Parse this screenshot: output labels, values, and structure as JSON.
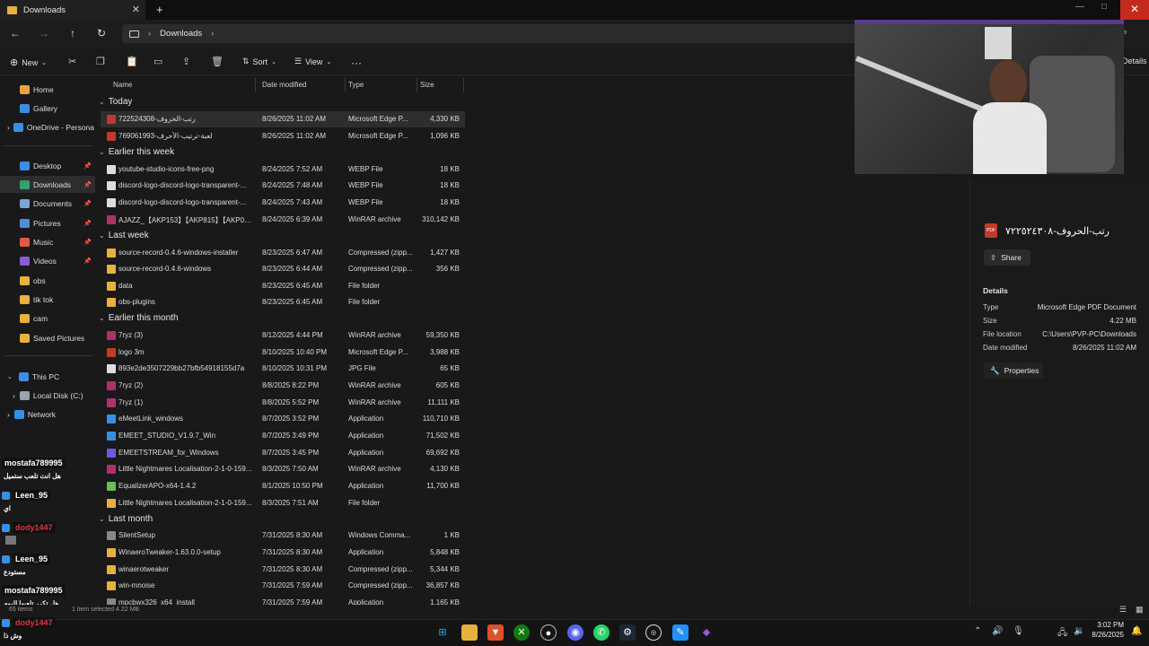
{
  "window": {
    "tab_title": "Downloads",
    "new_tab": "+",
    "minimize": "—",
    "maximize": "□",
    "close": "✕"
  },
  "nav": {
    "breadcrumb": "Downloads",
    "search_icon": "search-icon"
  },
  "toolbar": {
    "new_label": "New",
    "sort_label": "Sort",
    "view_label": "View",
    "more": "···",
    "details_label": "Details"
  },
  "sidebar": {
    "items": [
      {
        "label": "Home",
        "color": "#e8a33d"
      },
      {
        "label": "Gallery",
        "color": "#3a8ee6"
      },
      {
        "label": "OneDrive - Persona",
        "color": "#3a8ee6"
      },
      {
        "label": "Desktop",
        "color": "#3a8ee6"
      },
      {
        "label": "Downloads",
        "color": "#2fa36b"
      },
      {
        "label": "Documents",
        "color": "#7aa6d9"
      },
      {
        "label": "Pictures",
        "color": "#4d8fd6"
      },
      {
        "label": "Music",
        "color": "#e05a47"
      },
      {
        "label": "Videos",
        "color": "#8b5bd6"
      },
      {
        "label": "obs",
        "color": "#e8b13d"
      },
      {
        "label": "tik tok",
        "color": "#e8b13d"
      },
      {
        "label": "cam",
        "color": "#e8b13d"
      },
      {
        "label": "Saved Pictures",
        "color": "#e8b13d"
      },
      {
        "label": "This PC",
        "color": "#3a8ee6"
      },
      {
        "label": "Local Disk (C:)",
        "color": "#9aa4b0"
      },
      {
        "label": "Network",
        "color": "#3a8ee6"
      }
    ]
  },
  "columns": {
    "name": "Name",
    "date": "Date modified",
    "type": "Type",
    "size": "Size"
  },
  "groups": {
    "today": "Today",
    "earlier_week": "Earlier this week",
    "last_week": "Last week",
    "earlier_month": "Earlier this month",
    "last_month": "Last month"
  },
  "files": [
    {
      "name": "722524308-رتب-الحروف",
      "date": "8/26/2025 11:02 AM",
      "type": "Microsoft Edge P...",
      "size": "4,330 KB",
      "icon": "#c0392b"
    },
    {
      "name": "769061993-لعبة-ترتيب-الأحرف",
      "date": "8/26/2025 11:02 AM",
      "type": "Microsoft Edge P...",
      "size": "1,096 KB",
      "icon": "#c0392b"
    },
    {
      "name": "youtube-studio-icons-free-png",
      "date": "8/24/2025 7:52 AM",
      "type": "WEBP File",
      "size": "18 KB",
      "icon": "#dddddd"
    },
    {
      "name": "discord-logo-discord-logo-transparent-...",
      "date": "8/24/2025 7:48 AM",
      "type": "WEBP File",
      "size": "18 KB",
      "icon": "#dddddd"
    },
    {
      "name": "discord-logo-discord-logo-transparent-...",
      "date": "8/24/2025 7:43 AM",
      "type": "WEBP File",
      "size": "18 KB",
      "icon": "#dddddd"
    },
    {
      "name": "AJAZZ_【AKP153】【AKP815】【AKP03】【AK...",
      "date": "8/24/2025 6:39 AM",
      "type": "WinRAR archive",
      "size": "310,142 KB",
      "icon": "#b0306a"
    },
    {
      "name": "source-record-0.4.6-windows-installer",
      "date": "8/23/2025 6:47 AM",
      "type": "Compressed (zipp...",
      "size": "1,427 KB",
      "icon": "#e8b13d"
    },
    {
      "name": "source-record-0.4.6-windows",
      "date": "8/23/2025 6:44 AM",
      "type": "Compressed (zipp...",
      "size": "356 KB",
      "icon": "#e8b13d"
    },
    {
      "name": "data",
      "date": "8/23/2025 6:45 AM",
      "type": "File folder",
      "size": "",
      "icon": "#e8b13d"
    },
    {
      "name": "obs-plugins",
      "date": "8/23/2025 6:45 AM",
      "type": "File folder",
      "size": "",
      "icon": "#e8b13d"
    },
    {
      "name": "7ryz (3)",
      "date": "8/12/2025 4:44 PM",
      "type": "WinRAR archive",
      "size": "59,350 KB",
      "icon": "#b0306a"
    },
    {
      "name": "logo 3m",
      "date": "8/10/2025 10:40 PM",
      "type": "Microsoft Edge P...",
      "size": "3,988 KB",
      "icon": "#c0392b"
    },
    {
      "name": "893e2de3507229bb27bfb54918155d7a",
      "date": "8/10/2025 10:31 PM",
      "type": "JPG File",
      "size": "65 KB",
      "icon": "#dddddd"
    },
    {
      "name": "7ryz (2)",
      "date": "8/8/2025 8:22 PM",
      "type": "WinRAR archive",
      "size": "605 KB",
      "icon": "#b0306a"
    },
    {
      "name": "7ryz (1)",
      "date": "8/8/2025 5:52 PM",
      "type": "WinRAR archive",
      "size": "11,111 KB",
      "icon": "#b0306a"
    },
    {
      "name": "eMeetLink_windows",
      "date": "8/7/2025 3:52 PM",
      "type": "Application",
      "size": "110,710 KB",
      "icon": "#3a8ee6"
    },
    {
      "name": "EMEET_STUDIO_V1.9.7_Win",
      "date": "8/7/2025 3:49 PM",
      "type": "Application",
      "size": "71,502 KB",
      "icon": "#3a8ee6"
    },
    {
      "name": "EMEETSTREAM_for_Windows",
      "date": "8/7/2025 3:45 PM",
      "type": "Application",
      "size": "69,692 KB",
      "icon": "#6a5be0"
    },
    {
      "name": "Little Nightmares Localisation-2-1-0-159...",
      "date": "8/3/2025 7:50 AM",
      "type": "WinRAR archive",
      "size": "4,130 KB",
      "icon": "#b0306a"
    },
    {
      "name": "EqualizerAPO-x64-1.4.2",
      "date": "8/1/2025 10:50 PM",
      "type": "Application",
      "size": "11,700 KB",
      "icon": "#6abf5a"
    },
    {
      "name": "Little Nightmares Localisation-2-1-0-159...",
      "date": "8/3/2025 7:51 AM",
      "type": "File folder",
      "size": "",
      "icon": "#e8b13d"
    },
    {
      "name": "SilentSetup",
      "date": "7/31/2025 8:30 AM",
      "type": "Windows Comma...",
      "size": "1 KB",
      "icon": "#888888"
    },
    {
      "name": "WinaeroTweaker-1.63.0.0-setup",
      "date": "7/31/2025 8:30 AM",
      "type": "Application",
      "size": "5,848 KB",
      "icon": "#e8b13d"
    },
    {
      "name": "winaerotweaker",
      "date": "7/31/2025 8:30 AM",
      "type": "Compressed (zipp...",
      "size": "5,344 KB",
      "icon": "#e8b13d"
    },
    {
      "name": "win-mnoise",
      "date": "7/31/2025 7:59 AM",
      "type": "Compressed (zipp...",
      "size": "36,857 KB",
      "icon": "#e8b13d"
    },
    {
      "name": "mpcbwx326_x64_install",
      "date": "7/31/2025 7:59 AM",
      "type": "Application",
      "size": "1,165 KB",
      "icon": "#888888"
    }
  ],
  "details": {
    "file_title": "رتب-الحروف-٧٢٢٥٢٤٣٠٨",
    "share": "Share",
    "header": "Details",
    "rows": [
      {
        "k": "Type",
        "v": "Microsoft Edge PDF Document"
      },
      {
        "k": "Size",
        "v": "4.22 MB"
      },
      {
        "k": "File location",
        "v": "C:\\Users\\PVP-PC\\Downloads"
      },
      {
        "k": "Date modified",
        "v": "8/26/2025 11:02 AM"
      }
    ],
    "properties": "Properties"
  },
  "status": {
    "items": "65 items",
    "selected": "1 item selected  4.22 MB"
  },
  "chat": [
    {
      "user": "mostafa789995",
      "msg": "هل انت تلعب ستميل",
      "color": "#ffffff"
    },
    {
      "user": "Leen_95",
      "msg": "اي",
      "color": "#ffffff"
    },
    {
      "user": "dody1447",
      "msg": "",
      "color": "#e0304a"
    },
    {
      "user": "Leen_95",
      "msg": "مستودع",
      "color": "#ffffff"
    },
    {
      "user": "mostafa789995",
      "msg": "هل تكرر تلعبها اليوم",
      "color": "#ffffff"
    },
    {
      "user": "dody1447",
      "msg": "وش ذا",
      "color": "#e0304a"
    }
  ],
  "clock": {
    "time": "3:02 PM",
    "date": "8/26/2025"
  }
}
